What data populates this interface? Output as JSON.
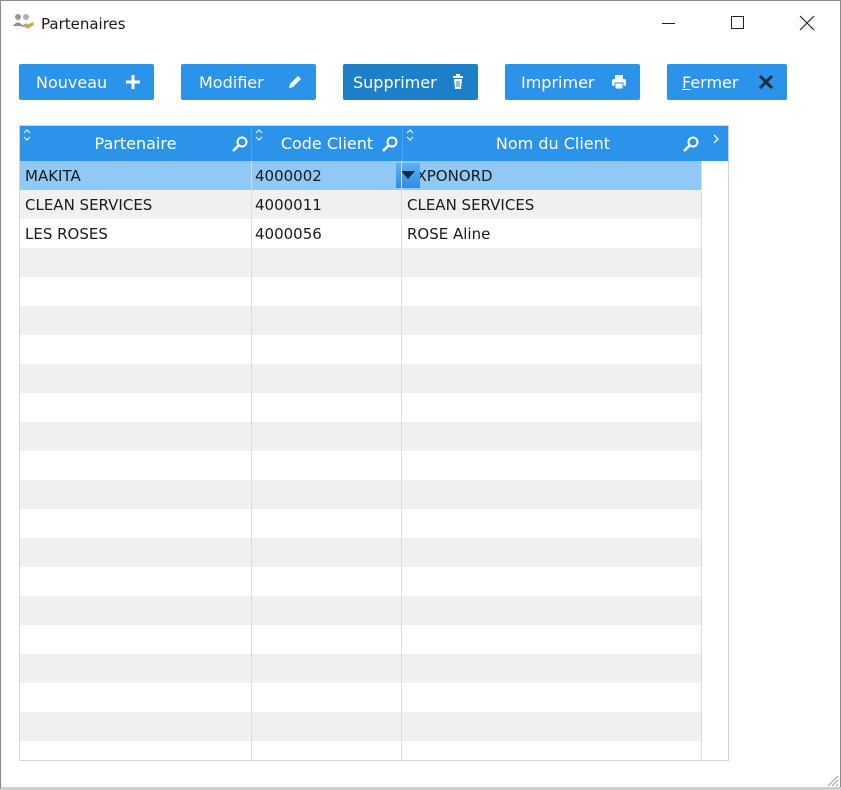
{
  "window": {
    "title": "Partenaires"
  },
  "toolbar": {
    "nouveau": "Nouveau",
    "modifier": "Modifier",
    "supprimer": "Supprimer",
    "imprimer": "Imprimer",
    "fermer_accel": "F",
    "fermer_rest": "ermer"
  },
  "grid": {
    "columns": [
      "Partenaire",
      "Code Client",
      "Nom du Client"
    ],
    "rows": [
      [
        "MAKITA",
        "4000002",
        "EXPONORD"
      ],
      [
        "CLEAN SERVICES",
        "4000011",
        "CLEAN SERVICES"
      ],
      [
        "LES ROSES",
        "4000056",
        "ROSE Aline"
      ]
    ],
    "selected_row": 0
  },
  "colors": {
    "accent": "#2b93ea",
    "selected_row": "#90c8f6",
    "alt_row": "#f0f0f0"
  },
  "icons": {
    "app": "people-icon",
    "nouveau": "plus-icon",
    "modifier": "pencil-icon",
    "supprimer": "trash-icon",
    "imprimer": "printer-icon",
    "fermer": "close-x-icon",
    "header_filter": "magnifier-icon",
    "sort": "sort-arrows-icon"
  }
}
